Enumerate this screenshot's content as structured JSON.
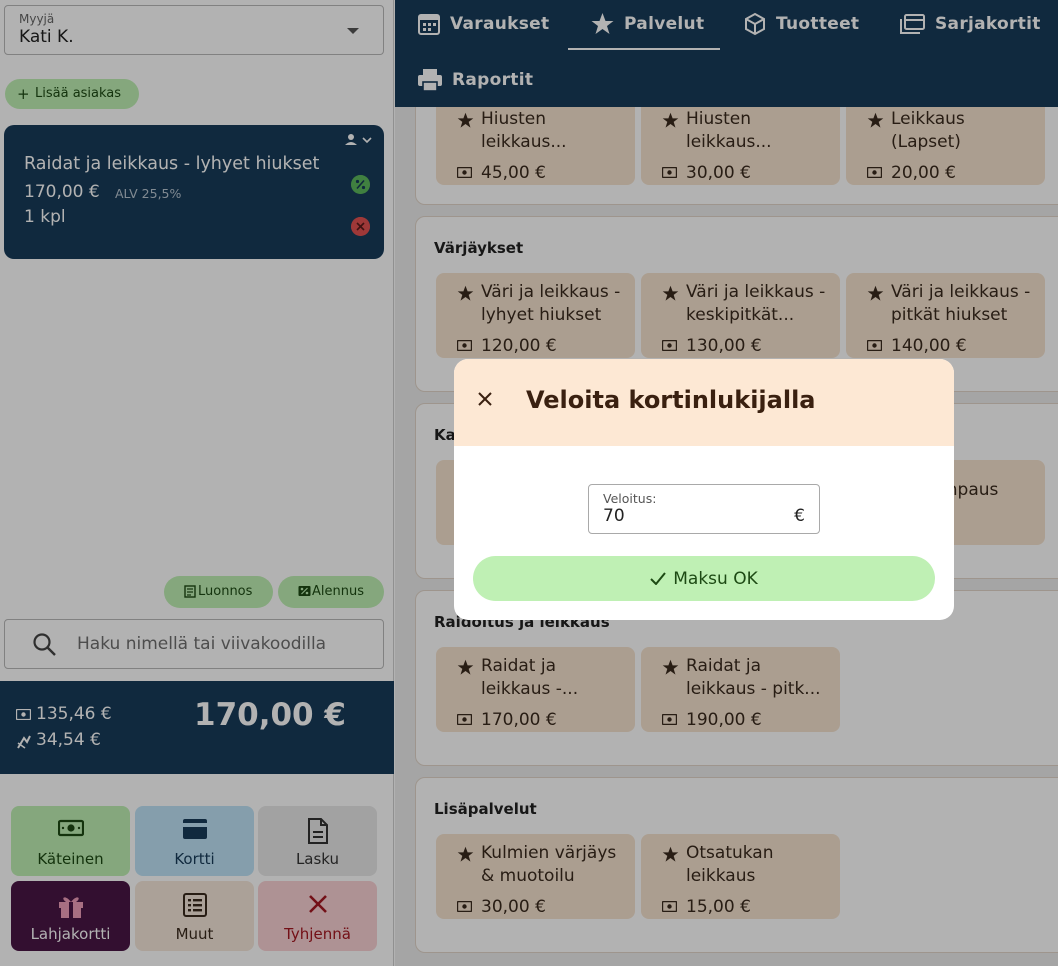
{
  "seller": {
    "label": "Myyjä",
    "value": "Kati K."
  },
  "add_customer": {
    "label": "Lisää asiakas"
  },
  "cart": {
    "items": [
      {
        "name": "Raidat ja leikkaus - lyhyet hiukset",
        "price": "170,00 €",
        "vat": "ALV 25,5%",
        "qty": "1 kpl"
      }
    ]
  },
  "actions": {
    "draft": "Luonnos",
    "discount": "Alennus"
  },
  "search": {
    "placeholder": "Haku nimellä tai viivakoodilla"
  },
  "totals": {
    "net": "135,46 €",
    "tax": "34,54 €",
    "total": "170,00 €"
  },
  "payment_buttons": {
    "cash": "Käteinen",
    "card": "Kortti",
    "invoice": "Lasku",
    "gift": "Lahjakortti",
    "other": "Muut",
    "clear": "Tyhjennä"
  },
  "nav": {
    "tabs": [
      "Varaukset",
      "Palvelut",
      "Tuotteet",
      "Sarjakortit",
      "Raportit"
    ],
    "active": "Palvelut"
  },
  "sections": [
    {
      "title": "",
      "tiles": [
        {
          "name": "Hiusten leikkaus...",
          "price": "45,00 €"
        },
        {
          "name": "Hiusten leikkaus...",
          "price": "30,00 €"
        },
        {
          "name": "Leikkaus (Lapset)",
          "price": "20,00 €"
        }
      ]
    },
    {
      "title": "Värjäykset",
      "tiles": [
        {
          "name": "Väri ja leikkaus - lyhyet hiukset",
          "price": "120,00 €"
        },
        {
          "name": "Väri ja leikkaus - keskipitkät...",
          "price": "130,00 €"
        },
        {
          "name": "Väri ja leikkaus - pitkät hiukset",
          "price": "140,00 €"
        }
      ]
    },
    {
      "title": "Ka",
      "tiles": [
        {
          "name": "",
          "price": ""
        },
        {
          "name": "",
          "price": ""
        },
        {
          "name": "mpaus",
          "price": ""
        }
      ]
    },
    {
      "title": "Raidoitus ja leikkaus",
      "tiles": [
        {
          "name": "Raidat ja leikkaus -...",
          "price": "170,00 €"
        },
        {
          "name": "Raidat ja leikkaus - pitk...",
          "price": "190,00 €"
        }
      ]
    },
    {
      "title": "Lisäpalvelut",
      "tiles": [
        {
          "name": "Kulmien värjäys & muotoilu",
          "price": "30,00 €"
        },
        {
          "name": "Otsatukan leikkaus",
          "price": "15,00 €"
        }
      ]
    }
  ],
  "modal": {
    "title": "Veloita kortinlukijalla",
    "amount_label": "Veloitus:",
    "amount_value": "70",
    "currency": "€",
    "confirm": "Maksu OK"
  },
  "colors": {
    "navy": "#173b59",
    "green": "#bff0b4",
    "tile": "#f5e3cf",
    "modal_header": "#fde8d4",
    "gift": "#4a1646",
    "clear": "#fad1d4"
  }
}
